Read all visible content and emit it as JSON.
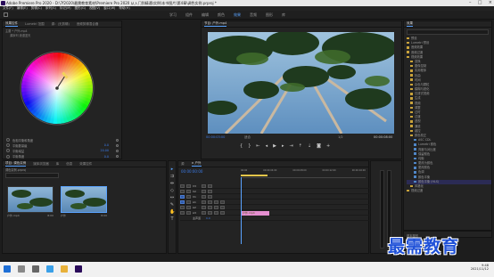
{
  "titlebar": {
    "title": "Adobe Premiere Pro 2020 - D:\\7f2020\\最需教育素材\\Premiere Pro 2020 从入门到精通\\实例\\本书图片\\第4章\\调色实例.prproj *"
  },
  "menu": [
    "文件(F)",
    "编辑(E)",
    "剪辑(C)",
    "序列(S)",
    "标记(M)",
    "图形(G)",
    "视图(V)",
    "窗口(W)",
    "帮助(H)"
  ],
  "workspaces": {
    "items": [
      "学习",
      "组件",
      "编辑",
      "颜色",
      "效果",
      "音频",
      "图形",
      "库"
    ],
    "active_index": 4
  },
  "lumetri": {
    "tabs": [
      "效果控件",
      "Lumetri 范围",
      "源：(无剪辑)",
      "音频剪辑混合器"
    ],
    "header_seq": "主要 * 户外.mp4",
    "effect": "源序列 浪漫蓝天",
    "rows": [
      {
        "label": "色相平衡和角度",
        "value": ""
      },
      {
        "label": "平衡数量级",
        "value": "0.0"
      },
      {
        "label": "平衡增益",
        "value": "20.00"
      },
      {
        "label": "平衡角度",
        "value": "0.0"
      },
      {
        "label": "辅比度",
        "value": "0.00"
      }
    ]
  },
  "monitor": {
    "tabs": [
      "节目: 户外.mp4"
    ],
    "timecode_left": "00:00:03:00",
    "fit": "适合",
    "ratio": "1/2",
    "timecode_right": "00:00:08:00"
  },
  "project": {
    "tabs": [
      "项目: 调色实例",
      "媒体浏览器",
      "库",
      "信息",
      "效果控件"
    ],
    "path": "调色实例.prproj",
    "items": [
      {
        "name": "户外.mp4",
        "duration": "8:00"
      },
      {
        "name": "户外",
        "duration": "8:00"
      }
    ]
  },
  "timeline": {
    "tabs": [
      "源",
      "× 户外"
    ],
    "timecode": "00:00:00:00",
    "ruler": [
      "00:00",
      "00:00:04:00",
      "00:00:08:00",
      "00:00:12:00",
      "00:00:16:00"
    ],
    "tracks": [
      {
        "name": "V3",
        "kind": "video"
      },
      {
        "name": "V2",
        "kind": "video"
      },
      {
        "name": "V1",
        "kind": "video"
      },
      {
        "name": "A1",
        "kind": "audio"
      },
      {
        "name": "A2",
        "kind": "audio"
      },
      {
        "name": "A3",
        "kind": "audio"
      }
    ],
    "master": "主声道",
    "master_value": "0.0",
    "clip": "户外.mp4"
  },
  "effects": {
    "title": "效果",
    "tree": [
      {
        "t": "预设",
        "k": "folder",
        "i": 1
      },
      {
        "t": "Lumetri 预设",
        "k": "folder",
        "i": 1
      },
      {
        "t": "音频效果",
        "k": "folder",
        "i": 1
      },
      {
        "t": "音频过渡",
        "k": "folder",
        "i": 1
      },
      {
        "t": "视频效果",
        "k": "folder",
        "i": 1
      },
      {
        "t": "变换",
        "k": "folder",
        "i": 2
      },
      {
        "t": "图像控制",
        "k": "folder",
        "i": 2
      },
      {
        "t": "实用程序",
        "k": "folder",
        "i": 2
      },
      {
        "t": "扰曲",
        "k": "folder",
        "i": 2
      },
      {
        "t": "时间",
        "k": "folder",
        "i": 2
      },
      {
        "t": "杂色与颗粒",
        "k": "folder",
        "i": 2
      },
      {
        "t": "模糊与锐化",
        "k": "folder",
        "i": 2
      },
      {
        "t": "沉浸式视频",
        "k": "folder",
        "i": 2
      },
      {
        "t": "生成",
        "k": "folder",
        "i": 2
      },
      {
        "t": "视频",
        "k": "folder",
        "i": 2
      },
      {
        "t": "调整",
        "k": "folder",
        "i": 2
      },
      {
        "t": "过时",
        "k": "folder",
        "i": 2
      },
      {
        "t": "过渡",
        "k": "folder",
        "i": 2
      },
      {
        "t": "透视",
        "k": "folder",
        "i": 2
      },
      {
        "t": "通道",
        "k": "folder",
        "i": 2
      },
      {
        "t": "键控",
        "k": "folder",
        "i": 2
      },
      {
        "t": "颜色校正",
        "k": "folder",
        "i": 2
      },
      {
        "t": "ASC CDL",
        "k": "fx",
        "i": 3
      },
      {
        "t": "Lumetri 颜色",
        "k": "fx",
        "i": 3
      },
      {
        "t": "亮度与对比度",
        "k": "fx",
        "i": 3
      },
      {
        "t": "保留颜色",
        "k": "fx",
        "i": 3
      },
      {
        "t": "均衡",
        "k": "fx",
        "i": 3
      },
      {
        "t": "更改为颜色",
        "k": "fx",
        "i": 3
      },
      {
        "t": "更改颜色",
        "k": "fx",
        "i": 3
      },
      {
        "t": "色调",
        "k": "fx",
        "i": 3
      },
      {
        "t": "颜色平衡",
        "k": "fx",
        "i": 3
      },
      {
        "t": "颜色平衡 (HLS)",
        "k": "fx",
        "i": 3,
        "sel": true
      },
      {
        "t": "风格化",
        "k": "folder",
        "i": 2
      },
      {
        "t": "视频过渡",
        "k": "folder",
        "i": 1
      }
    ],
    "subpanel": "基本图形"
  },
  "watermark": "最需教育",
  "taskbar": {
    "time": "9:48",
    "date": "2021/11/12"
  },
  "colors": {
    "accent": "#5aa3ff",
    "clip": "#e58fd0",
    "timecode": "#3b7be8"
  }
}
